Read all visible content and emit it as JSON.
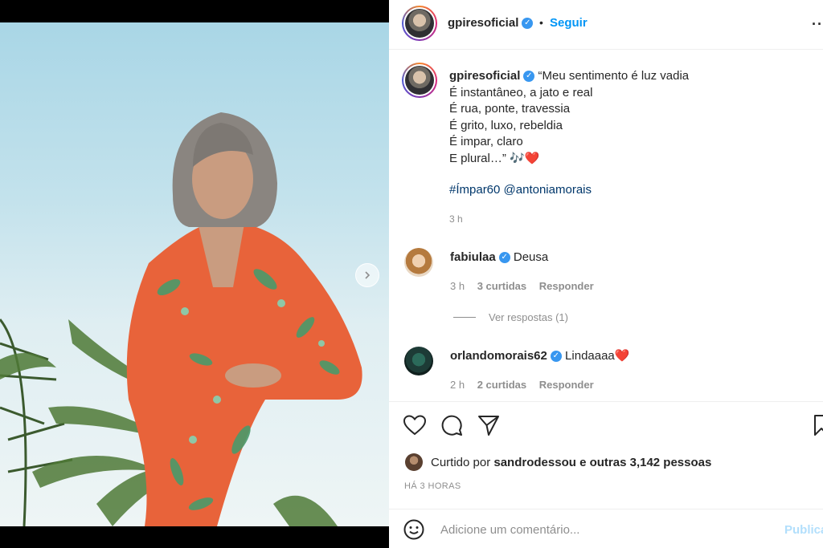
{
  "post": {
    "author": "gpiresoficial",
    "follow_label": "Seguir",
    "separator": "•",
    "more_label": "···",
    "caption_lines": [
      "“Meu sentimento é luz vadia",
      "É instantâneo, a jato e real",
      "É rua, ponte, travessia",
      "É grito, luxo, rebeldia",
      "É impar, claro",
      "E plural…”"
    ],
    "caption_emojis": "🎶❤️",
    "hashtag": "#Ímpar60",
    "mention": "@antoniamorais",
    "caption_time": "3 h"
  },
  "comments": [
    {
      "user": "fabiulaa",
      "text": "Deusa",
      "time": "3 h",
      "likes": "3 curtidas",
      "reply": "Responder"
    },
    {
      "user": "orlandomorais62",
      "text": "Lindaaaa❤️",
      "time": "2 h",
      "likes": "2 curtidas",
      "reply": "Responder"
    }
  ],
  "view_replies": "Ver respostas (1)",
  "likes_summary": {
    "prefix": "Curtido por",
    "user": "sandrodessou",
    "suffix": "e outras 3,142 pessoas"
  },
  "posted_ago": "HÁ 3 HORAS",
  "add_comment": {
    "placeholder": "Adicione um comentário...",
    "publish": "Publicar"
  },
  "colors": {
    "accent": "#0095f6",
    "verified": "#3897f0",
    "heart": "#ed4956"
  }
}
